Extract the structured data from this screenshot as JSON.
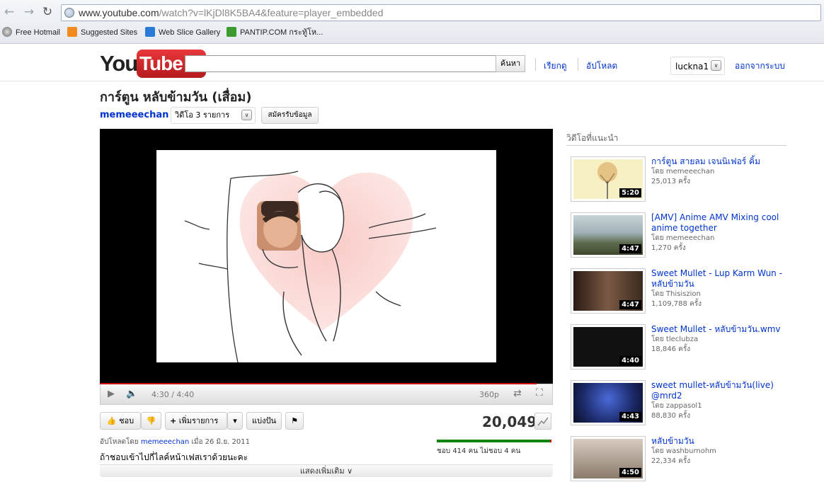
{
  "browser": {
    "url_host": "www.youtube.com",
    "url_rest": "/watch?v=lKjDl8K5BA4&feature=player_embedded",
    "favorites": [
      "Free Hotmail",
      "Suggested Sites",
      "Web Slice Gallery",
      "PANTIP.COM กระทู้โห..."
    ]
  },
  "header": {
    "logo_you": "You",
    "logo_tube": "Tube",
    "search_placeholder": "",
    "search_button": "ค้นหา",
    "browse_link": "เรียกดู",
    "upload_link": "อัปโหลด",
    "username": "luckna1",
    "signout_link": "ออกจากระบบ"
  },
  "video": {
    "title": "การ์ตูน หลับข้ามวัน (เสื่อม)",
    "channel": "memeeechan",
    "video_count": "วิดีโอ 3 รายการ",
    "subscribe": "สมัครรับข้อมูล",
    "time": "4:30 / 4:40",
    "quality": "360p",
    "progress": 0.964,
    "like_button": "ชอบ",
    "add_button": "เพิ่มรายการ",
    "share_button": "แบ่งปัน",
    "views": "20,049",
    "uploaded_prefix": "อัปโหลดโดย",
    "uploaded_by": "memeeechan",
    "uploaded_date": "เมื่อ 26 มิ.ย. 2011",
    "description": "ถ้าชอบเข้าไปกี่ไลค์หน้าเฟสเราด้วยนะคะ",
    "like_stats": "ชอบ 414 คน ไม่ชอบ 4 คน",
    "likes": 414,
    "dislikes": 4,
    "show_more": "แสดงเพิ่มเติม"
  },
  "sidebar": {
    "heading": "วิดีโอที่แนะนำ",
    "items": [
      {
        "title": "การ์ตูน สายลม เจนนิเฟอร์ คิ้ม",
        "by": "โดย memeeechan",
        "views": "25,013 ครั้ง",
        "duration": "5:20",
        "thumb_color": "#f6f0c2"
      },
      {
        "title": "[AMV] Anime AMV Mixing cool anime together",
        "by": "โดย memeeechan",
        "views": "1,270 ครั้ง",
        "duration": "4:47",
        "thumb_color": "#8aa0a8"
      },
      {
        "title": "Sweet Mullet - Lup Karm Wun - หลับข้ามวัน",
        "by": "โดย Thisiszion",
        "views": "1,109,788 ครั้ง",
        "duration": "4:47",
        "thumb_color": "#5a3a2c"
      },
      {
        "title": "Sweet Mullet - หลับข้ามวัน.wmv",
        "by": "โดย tleclubza",
        "views": "18,846 ครั้ง",
        "duration": "4:40",
        "thumb_color": "#111111"
      },
      {
        "title": "sweet mullet-หลับข้ามวัน(live) @mrd2",
        "by": "โดย zappasol1",
        "views": "88,830 ครั้ง",
        "duration": "4:43",
        "thumb_color": "#1c2a6a"
      },
      {
        "title": "หลับข้ามวัน",
        "by": "โดย washburnohm",
        "views": "22,334 ครั้ง",
        "duration": "4:50",
        "thumb_color": "#b9a99a"
      }
    ]
  },
  "colors": {
    "link": "#0033cc",
    "like_bar": "#10840d",
    "dislike_bar": "#cc0000",
    "heart": "#f6b3b3"
  }
}
